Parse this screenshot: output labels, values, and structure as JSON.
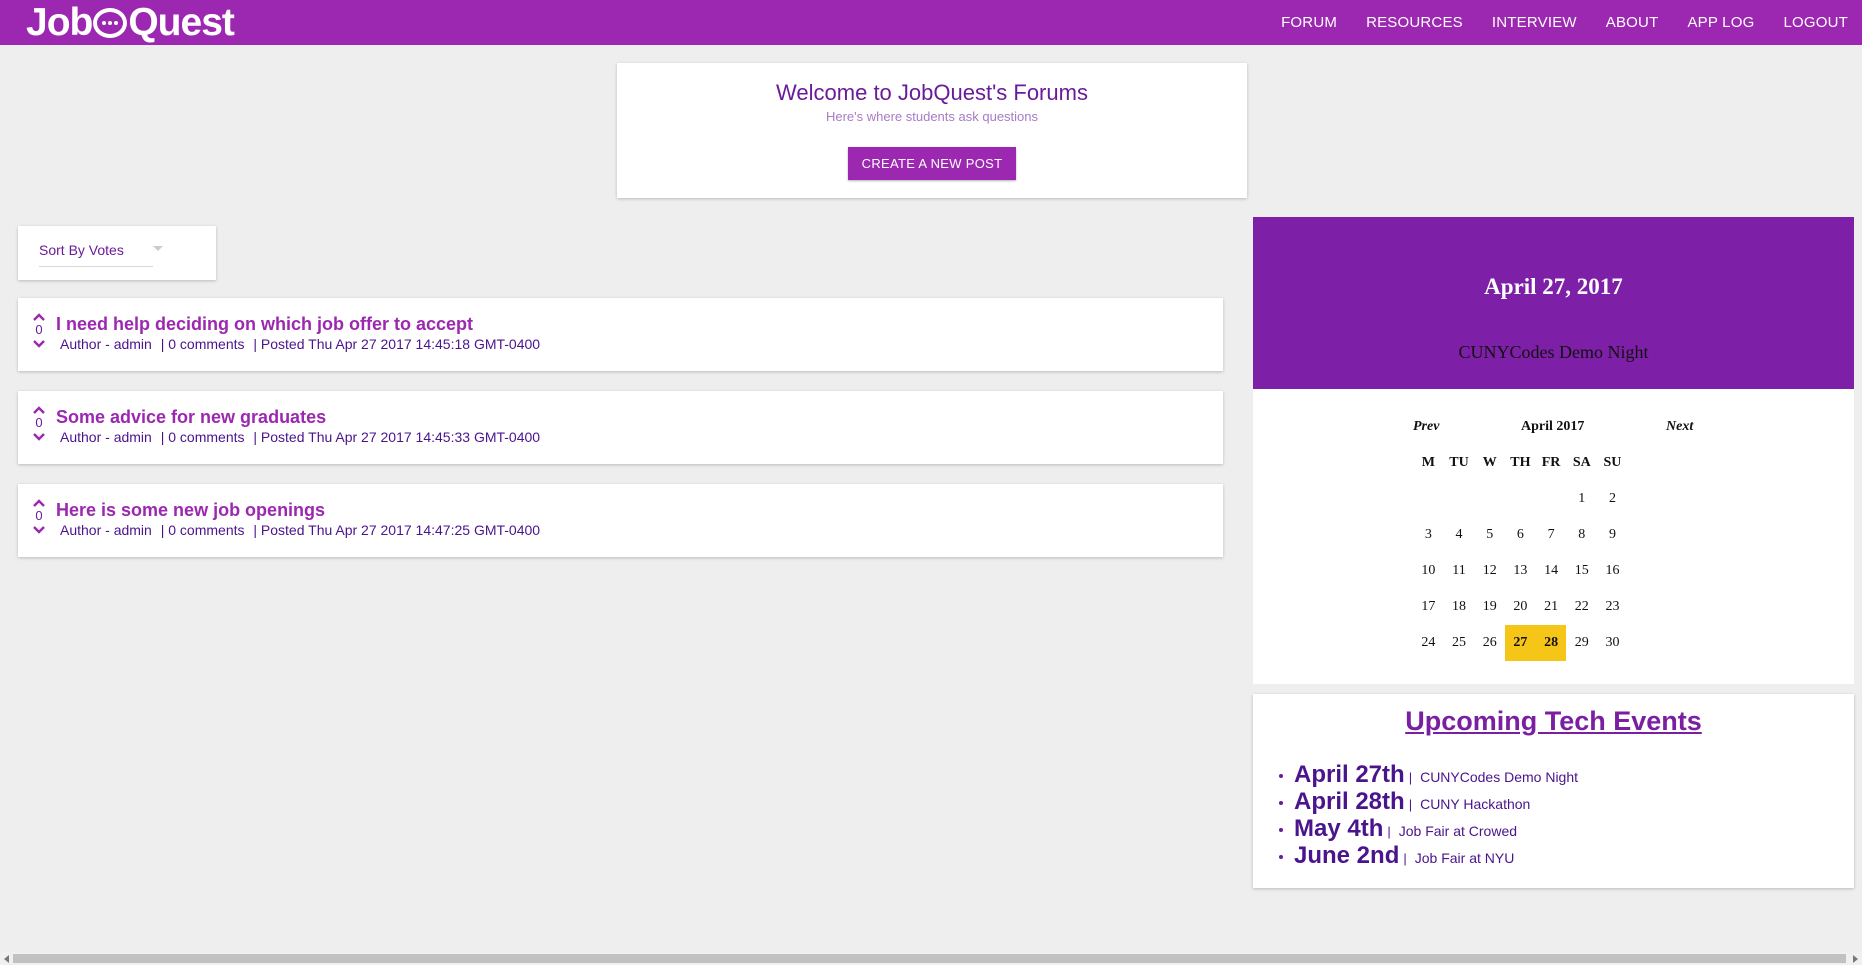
{
  "app": {
    "logo_text_left": "Job",
    "logo_text_right": "Quest"
  },
  "nav": {
    "items": [
      "FORUM",
      "RESOURCES",
      "INTERVIEW",
      "ABOUT",
      "APP LOG",
      "LOGOUT"
    ]
  },
  "welcome": {
    "title": "Welcome to JobQuest's Forums",
    "subtitle": "Here's where students ask questions",
    "create_label": "CREATE A NEW POST"
  },
  "sort": {
    "selected": "Sort By Votes"
  },
  "posts": [
    {
      "votes": "0",
      "title": "I need help deciding on which job offer to accept",
      "author": "Author - admin",
      "comments": "| 0 comments",
      "posted": "| Posted Thu Apr 27 2017 14:45:18 GMT-0400"
    },
    {
      "votes": "0",
      "title": "Some advice for new graduates",
      "author": "Author - admin",
      "comments": "| 0 comments",
      "posted": "| Posted Thu Apr 27 2017 14:45:33 GMT-0400"
    },
    {
      "votes": "0",
      "title": "Here is some new job openings",
      "author": "Author - admin",
      "comments": "| 0 comments",
      "posted": "| Posted Thu Apr 27 2017 14:47:25 GMT-0400"
    }
  ],
  "event_banner": {
    "date": "April 27, 2017",
    "event": "CUNYCodes Demo Night"
  },
  "calendar": {
    "prev_label": "Prev",
    "month_label": "April 2017",
    "next_label": "Next",
    "weekdays": [
      "M",
      "TU",
      "W",
      "TH",
      "FR",
      "SA",
      "SU"
    ],
    "weeks": [
      [
        "",
        "",
        "",
        "",
        "",
        "1",
        "2"
      ],
      [
        "3",
        "4",
        "5",
        "6",
        "7",
        "8",
        "9"
      ],
      [
        "10",
        "11",
        "12",
        "13",
        "14",
        "15",
        "16"
      ],
      [
        "17",
        "18",
        "19",
        "20",
        "21",
        "22",
        "23"
      ],
      [
        "24",
        "25",
        "26",
        "27",
        "28",
        "29",
        "30"
      ]
    ],
    "highlighted": [
      "27",
      "28"
    ],
    "highlight_color": "#f5c518"
  },
  "upcoming": {
    "title": "Upcoming Tech Events",
    "items": [
      {
        "date": "April 27th",
        "sep": "|",
        "name": "CUNYCodes Demo Night"
      },
      {
        "date": "April 28th",
        "sep": "|",
        "name": "CUNY Hackathon"
      },
      {
        "date": "May 4th",
        "sep": "|",
        "name": "Job Fair at Crowed"
      },
      {
        "date": "June 2nd",
        "sep": "|",
        "name": "Job Fair at NYU"
      }
    ]
  },
  "colors": {
    "brand_purple": "#9c27b0",
    "banner_purple": "#7e1fa8",
    "text_purple": "#6a1b9a",
    "background": "#eeeeee"
  },
  "icons": {
    "upvote": "chevron-up-icon",
    "downvote": "chevron-down-icon",
    "sort_caret": "caret-down-icon",
    "logo_bubble": "chat-bubble-icon"
  }
}
